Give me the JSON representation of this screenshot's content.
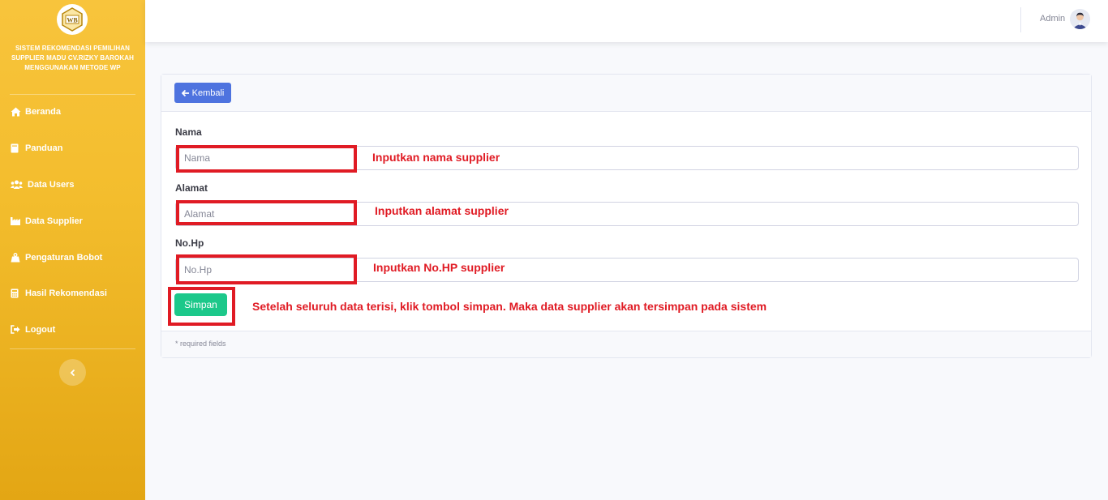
{
  "sidebar": {
    "logo_text": "WB",
    "brand_title": "SISTEM REKOMENDASI PEMILIHAN SUPPLIER MADU CV.RIZKY BAROKAH MENGGUNAKAN METODE WP",
    "items": [
      {
        "label": "Beranda",
        "icon": "home-icon"
      },
      {
        "label": "Panduan",
        "icon": "book-icon"
      },
      {
        "label": "Data Users",
        "icon": "users-icon"
      },
      {
        "label": "Data Supplier",
        "icon": "industry-icon"
      },
      {
        "label": "Pengaturan Bobot",
        "icon": "weight-icon"
      },
      {
        "label": "Hasil Rekomendasi",
        "icon": "calculator-icon"
      },
      {
        "label": "Logout",
        "icon": "sign-out-icon"
      }
    ],
    "toggle_icon": "chevron-left-icon"
  },
  "topbar": {
    "user_name": "Admin",
    "avatar_icon": "user-avatar"
  },
  "form": {
    "back_label": "Kembali",
    "back_icon": "arrow-left-icon",
    "fields": [
      {
        "label": "Nama",
        "placeholder": "Nama",
        "value": ""
      },
      {
        "label": "Alamat",
        "placeholder": "Alamat",
        "value": ""
      },
      {
        "label": "No.Hp",
        "placeholder": "No.Hp",
        "value": ""
      }
    ],
    "submit_label": "Simpan",
    "footer_note": "* required fields"
  },
  "annotations": {
    "nama": "Inputkan nama supplier",
    "alamat": "Inputkan alamat supplier",
    "nohp": "Inputkan No.HP supplier",
    "simpan": "Setelah seluruh data terisi, klik tombol simpan. Maka data supplier akan tersimpan pada sistem"
  },
  "colors": {
    "sidebar": "#f3bd2d",
    "primary": "#4e73df",
    "success": "#1cc88a",
    "annotation": "#e01b24"
  }
}
